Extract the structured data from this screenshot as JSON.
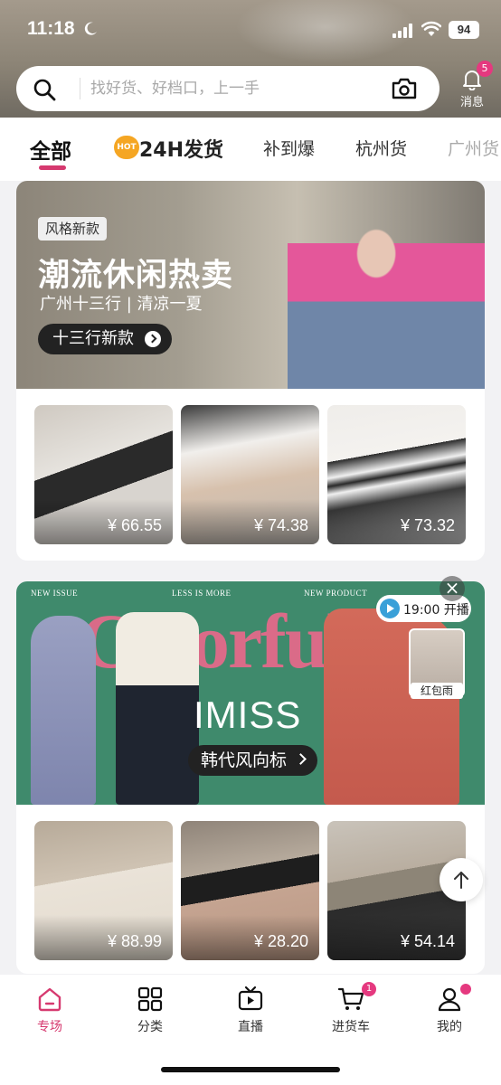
{
  "status_bar": {
    "time": "11:18",
    "battery": "94"
  },
  "search": {
    "placeholder": "找好货、好档口，上一手"
  },
  "messages": {
    "label": "消息",
    "badge": "5"
  },
  "tabs": {
    "hot_badge": "HOT",
    "items": [
      {
        "label": "全部",
        "active": true
      },
      {
        "label": "24H发货"
      },
      {
        "label": "补到爆"
      },
      {
        "label": "杭州货"
      },
      {
        "label": "广州货"
      }
    ]
  },
  "section_1": {
    "tag": "风格新款",
    "title": "潮流休闲热卖",
    "subtitle": "广州十三行 | 清凉一夏",
    "cta": "十三行新款",
    "products": [
      {
        "price": "¥ 66.55"
      },
      {
        "price": "¥ 74.38"
      },
      {
        "price": "¥ 73.32"
      }
    ]
  },
  "section_2": {
    "label_left": "NEW ISSUE",
    "label_mid": "LESS IS MORE",
    "label_right": "NEW PRODUCT",
    "overlay_text": "Colorful",
    "brand": "IMISS",
    "cta": "韩代风向标",
    "live_time": "19:00 开播",
    "red_packet": "红包雨",
    "products": [
      {
        "price": "¥ 88.99"
      },
      {
        "price": "¥ 28.20"
      },
      {
        "price": "¥ 54.14"
      }
    ]
  },
  "bottom_nav": {
    "items": [
      {
        "label": "专场",
        "active": true
      },
      {
        "label": "分类"
      },
      {
        "label": "直播"
      },
      {
        "label": "进货车",
        "badge": "1"
      },
      {
        "label": "我的"
      }
    ]
  },
  "colors": {
    "accent": "#d6396f",
    "badge": "#e5397f",
    "banner_green": "#3f8a6c"
  }
}
